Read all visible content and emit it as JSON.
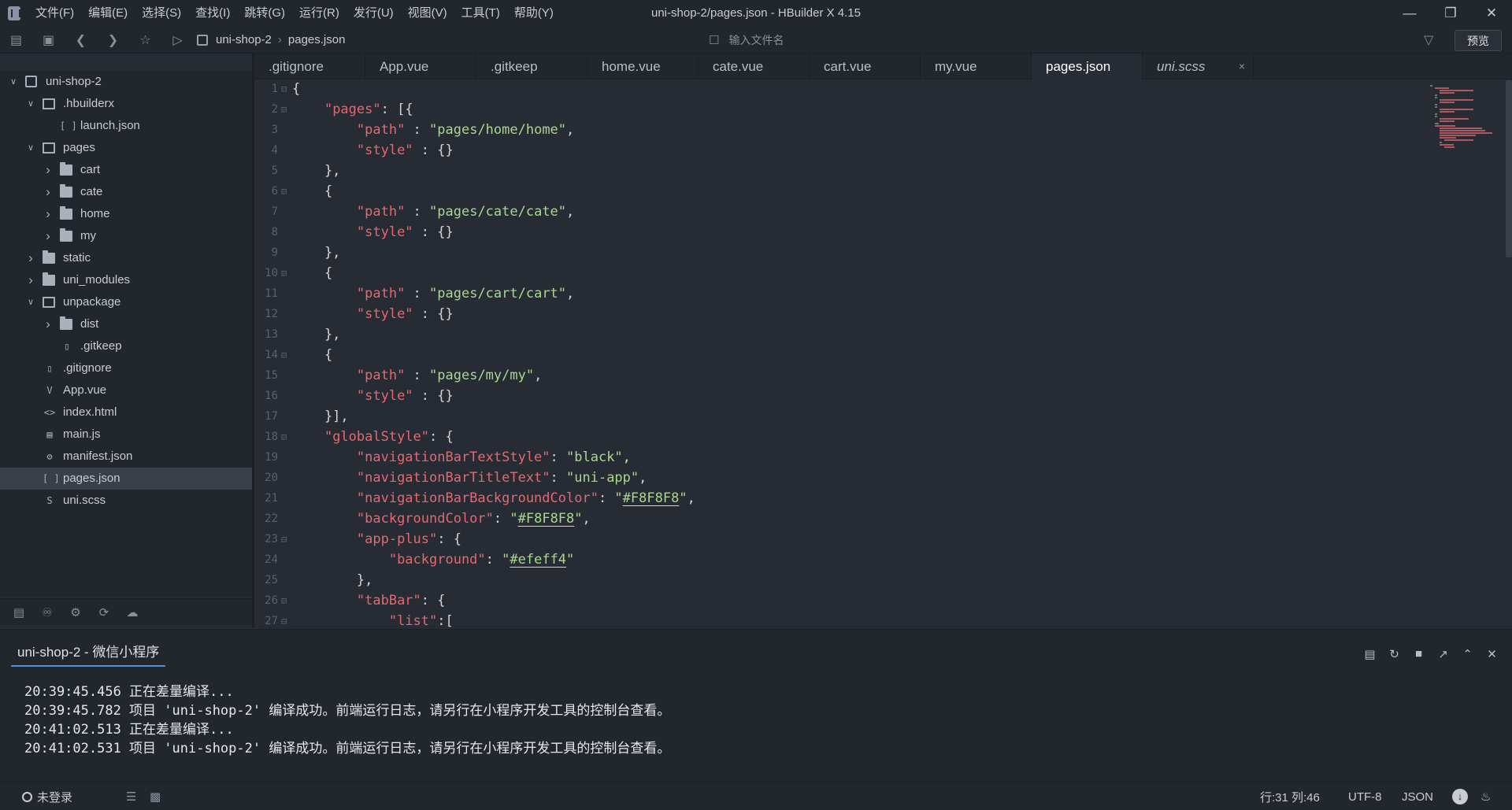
{
  "window": {
    "title": "uni-shop-2/pages.json - HBuilder X 4.15",
    "menu": [
      "文件(F)",
      "编辑(E)",
      "选择(S)",
      "查找(I)",
      "跳转(G)",
      "运行(R)",
      "发行(U)",
      "视图(V)",
      "工具(T)",
      "帮助(Y)"
    ]
  },
  "toolbar": {
    "breadcrumb": [
      "uni-shop-2",
      "pages.json"
    ],
    "file_search_placeholder": "输入文件名",
    "preview_label": "预览"
  },
  "sidebar": {
    "items": [
      {
        "label": "uni-shop-2",
        "icon": "project-icon",
        "expanded": true
      },
      {
        "label": ".hbuilderx",
        "icon": "folder-open-icon",
        "expanded": true
      },
      {
        "label": "launch.json",
        "icon": "json-file-icon"
      },
      {
        "label": "pages",
        "icon": "folder-open-icon",
        "expanded": true
      },
      {
        "label": "cart",
        "icon": "folder-icon",
        "expanded": false
      },
      {
        "label": "cate",
        "icon": "folder-icon",
        "expanded": false
      },
      {
        "label": "home",
        "icon": "folder-icon",
        "expanded": false
      },
      {
        "label": "my",
        "icon": "folder-icon",
        "expanded": false
      },
      {
        "label": "static",
        "icon": "folder-icon",
        "expanded": false
      },
      {
        "label": "uni_modules",
        "icon": "folder-icon",
        "expanded": false
      },
      {
        "label": "unpackage",
        "icon": "folder-open-icon",
        "expanded": true
      },
      {
        "label": "dist",
        "icon": "folder-icon",
        "expanded": false
      },
      {
        "label": ".gitkeep",
        "icon": "file-icon"
      },
      {
        "label": ".gitignore",
        "icon": "file-icon"
      },
      {
        "label": "App.vue",
        "icon": "vue-file-icon"
      },
      {
        "label": "index.html",
        "icon": "html-file-icon"
      },
      {
        "label": "main.js",
        "icon": "js-file-icon"
      },
      {
        "label": "manifest.json",
        "icon": "manifest-icon"
      },
      {
        "label": "pages.json",
        "icon": "json-file-icon",
        "selected": true
      },
      {
        "label": "uni.scss",
        "icon": "scss-file-icon"
      }
    ]
  },
  "tabs": [
    {
      "label": ".gitignore"
    },
    {
      "label": "App.vue"
    },
    {
      "label": ".gitkeep"
    },
    {
      "label": "home.vue"
    },
    {
      "label": "cate.vue"
    },
    {
      "label": "cart.vue"
    },
    {
      "label": "my.vue"
    },
    {
      "label": "pages.json",
      "active": true
    },
    {
      "label": "uni.scss",
      "italic": true,
      "close": "×"
    }
  ],
  "editor": {
    "lines": [
      {
        "n": "1",
        "fold": "⊟",
        "text": "{"
      },
      {
        "n": "2",
        "fold": "⊟",
        "text": "    \"pages\": [{"
      },
      {
        "n": "3",
        "fold": "",
        "text": "        \"path\" : \"pages/home/home\","
      },
      {
        "n": "4",
        "fold": "",
        "text": "        \"style\" : {}"
      },
      {
        "n": "5",
        "fold": "",
        "text": "    },"
      },
      {
        "n": "6",
        "fold": "⊟",
        "text": "    {"
      },
      {
        "n": "7",
        "fold": "",
        "text": "        \"path\" : \"pages/cate/cate\","
      },
      {
        "n": "8",
        "fold": "",
        "text": "        \"style\" : {}"
      },
      {
        "n": "9",
        "fold": "",
        "text": "    },"
      },
      {
        "n": "10",
        "fold": "⊟",
        "text": "    {"
      },
      {
        "n": "11",
        "fold": "",
        "text": "        \"path\" : \"pages/cart/cart\","
      },
      {
        "n": "12",
        "fold": "",
        "text": "        \"style\" : {}"
      },
      {
        "n": "13",
        "fold": "",
        "text": "    },"
      },
      {
        "n": "14",
        "fold": "⊟",
        "text": "    {"
      },
      {
        "n": "15",
        "fold": "",
        "text": "        \"path\" : \"pages/my/my\","
      },
      {
        "n": "16",
        "fold": "",
        "text": "        \"style\" : {}"
      },
      {
        "n": "17",
        "fold": "",
        "text": "    }],"
      },
      {
        "n": "18",
        "fold": "⊟",
        "text": "    \"globalStyle\": {"
      },
      {
        "n": "19",
        "fold": "",
        "text": "        \"navigationBarTextStyle\": \"black\","
      },
      {
        "n": "20",
        "fold": "",
        "text": "        \"navigationBarTitleText\": \"uni-app\","
      },
      {
        "n": "21",
        "fold": "",
        "text": "        \"navigationBarBackgroundColor\": \"#F8F8F8\","
      },
      {
        "n": "22",
        "fold": "",
        "text": "        \"backgroundColor\": \"#F8F8F8\","
      },
      {
        "n": "23",
        "fold": "⊟",
        "text": "        \"app-plus\": {"
      },
      {
        "n": "24",
        "fold": "",
        "text": "            \"background\": \"#efeff4\""
      },
      {
        "n": "25",
        "fold": "",
        "text": "        },"
      },
      {
        "n": "26",
        "fold": "⊟",
        "text": "        \"tabBar\": {"
      },
      {
        "n": "27",
        "fold": "⊟",
        "text": "            \"list\":["
      }
    ]
  },
  "console": {
    "tab_label": "uni-shop-2 - 微信小程序",
    "logs": [
      "20:39:45.456 正在差量编译...",
      "20:39:45.782 项目 'uni-shop-2' 编译成功。前端运行日志，请另行在小程序开发工具的控制台查看。",
      "20:41:02.513 正在差量编译...",
      "20:41:02.531 项目 'uni-shop-2' 编译成功。前端运行日志，请另行在小程序开发工具的控制台查看。"
    ]
  },
  "statusbar": {
    "login": "未登录",
    "position": "行:31  列:46",
    "encoding": "UTF-8",
    "language": "JSON"
  },
  "colors": {
    "background": "#272b33",
    "panel": "#22262d",
    "key": "#e36971",
    "string": "#a9d88d",
    "accent": "#4f8fd6"
  }
}
